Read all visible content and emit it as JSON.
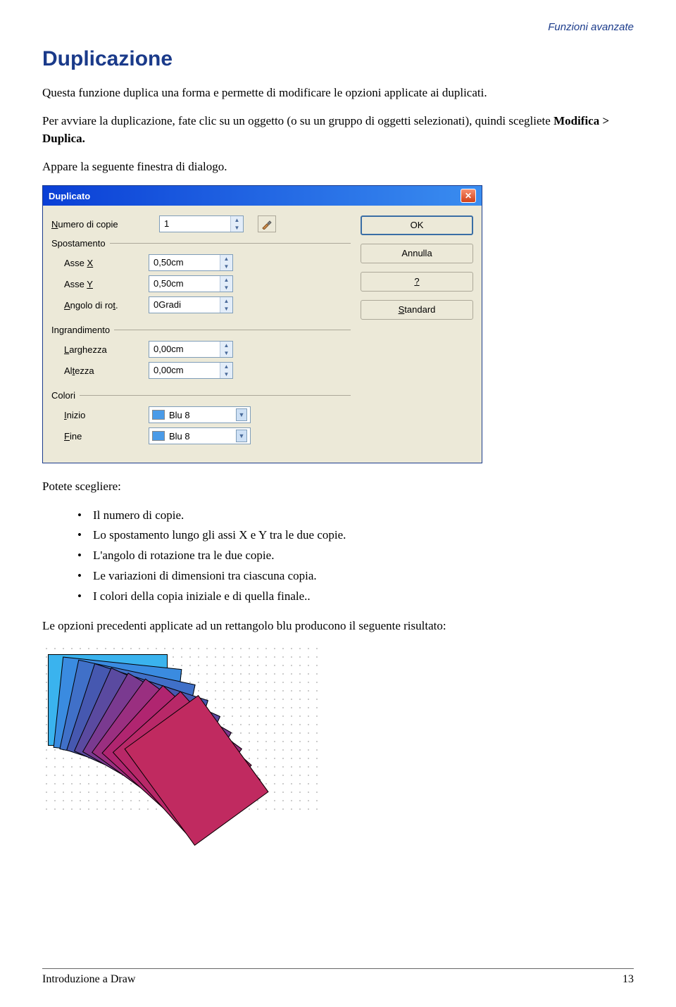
{
  "header": {
    "right": "Funzioni avanzate"
  },
  "section": {
    "title": "Duplicazione",
    "p1": "Questa funzione duplica una forma e permette di modificare le opzioni applicate ai duplicati.",
    "p2a": "Per avviare la duplicazione, fate clic su un oggetto (o su un gruppo di oggetti selezionati), quindi scegliete ",
    "p2b": "Modifica > Duplica.",
    "p3": "Appare la seguente finestra di dialogo."
  },
  "dialog": {
    "title": "Duplicato",
    "copies_label": "Numero di copie",
    "copies_value": "1",
    "groups": {
      "spostamento": "Spostamento",
      "ingrandimento": "Ingrandimento",
      "colori": "Colori"
    },
    "fields": {
      "asse_x": {
        "label": "Asse X",
        "value": "0,50cm"
      },
      "asse_y": {
        "label": "Asse Y",
        "value": "0,50cm"
      },
      "angolo": {
        "label": "Angolo di rot.",
        "value": "0Gradi"
      },
      "larghezza": {
        "label": "Larghezza",
        "value": "0,00cm"
      },
      "altezza": {
        "label": "Altezza",
        "value": "0,00cm"
      },
      "inizio": {
        "label": "Inizio",
        "value": "Blu 8",
        "hex": "#4a9be8"
      },
      "fine": {
        "label": "Fine",
        "value": "Blu 8",
        "hex": "#4a9be8"
      }
    },
    "buttons": {
      "ok": "OK",
      "annulla": "Annulla",
      "help": "?",
      "standard": "Standard"
    }
  },
  "after": {
    "lead": "Potete scegliere:",
    "items": {
      "a": "Il numero di copie.",
      "b": "Lo spostamento lungo gli assi X e Y tra le due copie.",
      "c": "L'angolo di rotazione tra le due copie.",
      "d": "Le variazioni di dimensioni tra ciascuna copia.",
      "e": "I colori della copia iniziale e di quella finale.."
    },
    "closing": "Le opzioni precedenti applicate ad un rettangolo blu producono il seguente risultato:"
  },
  "footer": {
    "left": "Introduzione a Draw",
    "right": "13"
  }
}
